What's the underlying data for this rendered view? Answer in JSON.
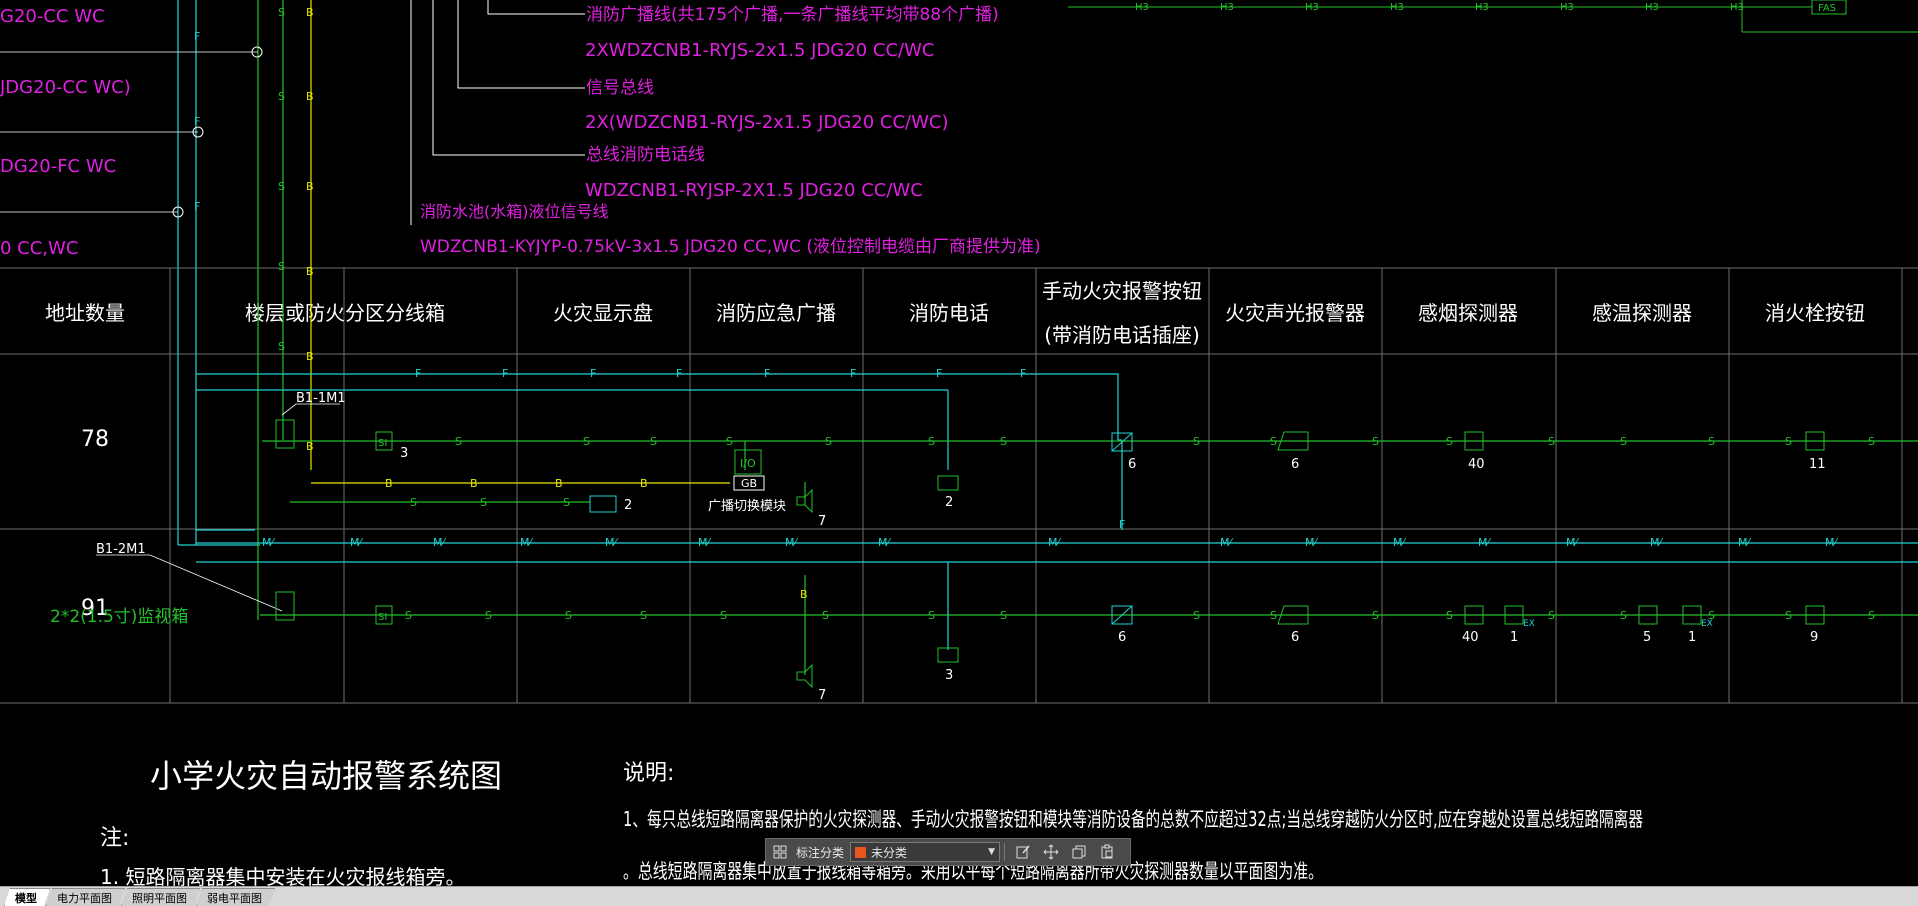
{
  "drawing": {
    "top_left_labels": [
      "G20-CC WC",
      "JDG20-CC WC)",
      "DG20-FC WC",
      "0 CC,WC"
    ],
    "cable_specs": [
      {
        "title": "消防广播线(共175个广播,一条广播线平均带88个广播)",
        "spec": "2XWDZCNB1-RYJS-2x1.5  JDG20 CC/WC"
      },
      {
        "title": "信号总线",
        "spec": "2X(WDZCNB1-RYJS-2x1.5  JDG20  CC/WC)"
      },
      {
        "title": "总线消防电话线",
        "spec": "WDZCNB1-RYJSP-2X1.5  JDG20 CC/WC"
      },
      {
        "title": "消防水池(水箱)液位信号线",
        "spec": "WDZCNB1-KYJYP-0.75kV-3x1.5  JDG20  CC,WC (液位控制电缆由厂商提供为准)"
      }
    ],
    "column_headers": [
      "地址数量",
      "楼层或防火分区分线箱",
      "火灾显示盘",
      "消防应急广播",
      "消防电话",
      "手动火灾报警按钮",
      "火灾声光报警器",
      "感烟探测器",
      "感温探测器",
      "消火栓按钮"
    ],
    "column_header_sub": "(带消防电话插座)",
    "row1": {
      "address_count": "78",
      "module_tag": "B1-1M1",
      "device_counts": [
        "3",
        "2",
        "7",
        "2",
        "6",
        "6",
        "40",
        "11"
      ],
      "gb_label": "GB",
      "io_label": "I/O",
      "broadcast_module_label": "广播切换模块"
    },
    "row2": {
      "address_count": "91",
      "module_tag": "B1-2M1",
      "monitor_label": "2*2(1.5寸)监视箱",
      "device_counts": [
        "7",
        "3",
        "6",
        "6",
        "40",
        "1",
        "5",
        "1",
        "9"
      ]
    },
    "bus_letters": {
      "F": "F",
      "S": "S",
      "B": "B",
      "ML": "M⁄",
      "H3": "H3",
      "FAS": "FAS",
      "SI": "SI",
      "EX": "EX"
    },
    "title": "小学火灾自动报警系统图",
    "note_label": "注:",
    "note_1": "1. 短路隔离器集中安装在火灾报线箱旁。",
    "explain_label": "说明:",
    "explain_1": "1、每只总线短路隔离器保护的火灾探测器、手动火灾报警按钮和模块等消防设备的总数不应超过32点;当总线穿越防火分区时,应在穿越处设置总线短路隔离器",
    "explain_2": "。总线短路隔离器集中放置于报线箱等箱旁。采用以平每个短路隔离器所带火灾探测器数量以平面图为准。"
  },
  "toolbar": {
    "label": "标注分类",
    "category_value": "未分类",
    "category_color": "#e8561d",
    "buttons": [
      "grid-icon",
      "edit-icon",
      "move-icon",
      "copy-icon",
      "paste-icon"
    ]
  },
  "tabs": [
    {
      "label": "模型",
      "active": true
    },
    {
      "label": "电力平面图",
      "active": false
    },
    {
      "label": "照明平面图",
      "active": false
    },
    {
      "label": "弱电平面图",
      "active": false
    }
  ],
  "colors": {
    "bg": "#000000",
    "cyan": "#22d3d3",
    "green": "#22c02a",
    "yellow": "#e6e600",
    "magenta": "#e020e0",
    "white": "#ffffff",
    "grid": "#707070"
  }
}
